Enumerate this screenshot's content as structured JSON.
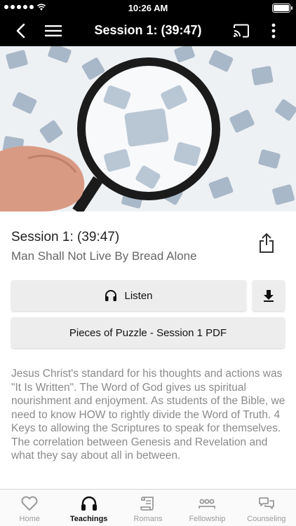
{
  "status": {
    "time": "10:26 AM"
  },
  "appbar": {
    "title": "Session 1:  (39:47)"
  },
  "session": {
    "title": "Session 1:  (39:47)",
    "subtitle": "Man Shall Not Live By Bread Alone"
  },
  "actions": {
    "listen_label": "Listen",
    "pdf_label": "Pieces of Puzzle - Session 1 PDF"
  },
  "description": "Jesus Christ's standard for his thoughts and actions was \"It Is Written\". The Word of God gives us spiritual nourishment and enjoyment.  As students of the Bible, we need to know HOW to rightly divide the Word of Truth.  4 Keys to allowing the Scriptures to speak for themselves. The correlation between Genesis and Revelation and what they say about all in between.",
  "tabs": [
    {
      "label": "Home",
      "icon": "heart-icon"
    },
    {
      "label": "Teachings",
      "icon": "headphones-icon",
      "active": true
    },
    {
      "label": "Romans",
      "icon": "scroll-icon"
    },
    {
      "label": "Fellowship",
      "icon": "people-icon"
    },
    {
      "label": "Counseling",
      "icon": "chat-icon"
    }
  ]
}
